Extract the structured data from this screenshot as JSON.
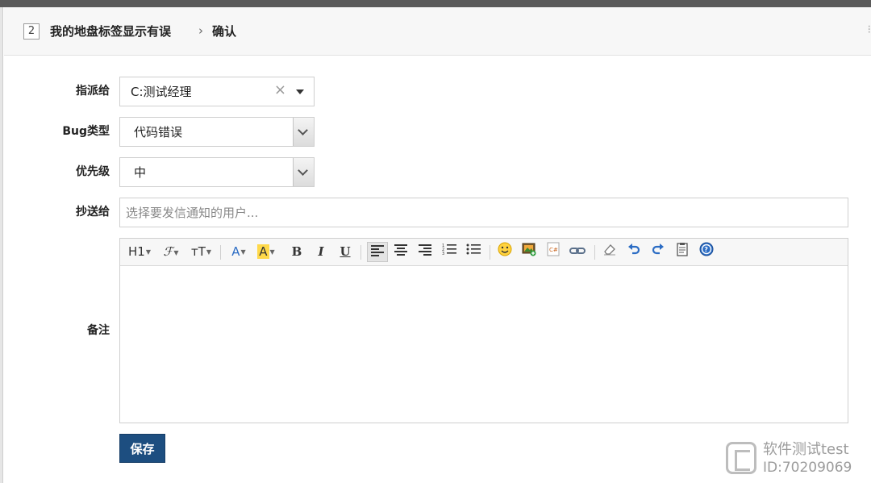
{
  "header": {
    "bug_id": "2",
    "bug_title": "我的地盘标签显示有误",
    "separator": "›",
    "current_page": "确认"
  },
  "form": {
    "assign_to": {
      "label": "指派给",
      "value": "C:测试经理",
      "clear_icon": "×"
    },
    "bug_type": {
      "label": "Bug类型",
      "value": "代码错误"
    },
    "priority": {
      "label": "优先级",
      "value": "中"
    },
    "cc": {
      "label": "抄送给",
      "placeholder": "选择要发信通知的用户..."
    },
    "comment": {
      "label": "备注"
    }
  },
  "toolbar": {
    "heading": "H1",
    "font": "𝓕",
    "font_size": "ᴛT",
    "font_color": "A",
    "bg_color": "A",
    "bold": "B",
    "italic": "I",
    "underline": "U",
    "icons": [
      "heading-icon",
      "font-family-icon",
      "font-size-icon",
      "font-color-icon",
      "highlight-icon",
      "bold-icon",
      "italic-icon",
      "underline-icon",
      "align-left-icon",
      "align-center-icon",
      "align-right-icon",
      "ordered-list-icon",
      "unordered-list-icon",
      "emoticon-icon",
      "image-icon",
      "code-icon",
      "link-icon",
      "eraser-icon",
      "undo-icon",
      "redo-icon",
      "paste-word-icon",
      "help-icon"
    ]
  },
  "actions": {
    "save_label": "保存"
  },
  "watermark": {
    "line1": "软件测试test",
    "line2": "ID:70209069"
  },
  "colors": {
    "save_button": "#1d4e80",
    "highlight": "#ffd94a",
    "link_blue": "#2b6cc4"
  }
}
